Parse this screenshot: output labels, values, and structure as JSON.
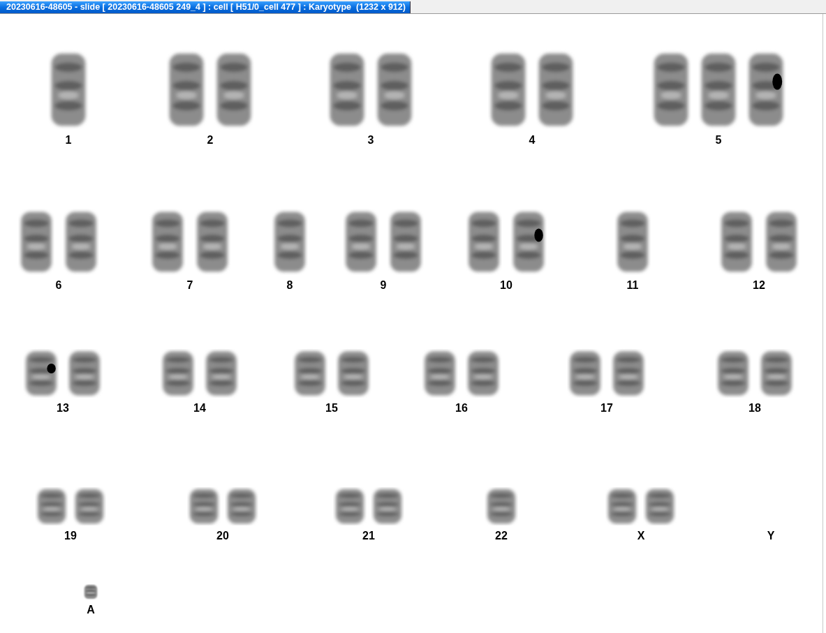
{
  "window": {
    "title": "20230616-48605 - slide [ 20230616-48605 249_4 ] : cell [ H51/0_cell 477 ] : Karyotype  (1232 x 912)"
  },
  "rows": [
    {
      "groups": [
        {
          "label": "1",
          "chromosomes": [
            {
              "kind": "normal"
            }
          ]
        },
        {
          "label": "2",
          "chromosomes": [
            {
              "kind": "normal"
            },
            {
              "kind": "normal"
            }
          ]
        },
        {
          "label": "3",
          "chromosomes": [
            {
              "kind": "normal"
            },
            {
              "kind": "normal"
            }
          ]
        },
        {
          "label": "4",
          "chromosomes": [
            {
              "kind": "normal"
            },
            {
              "kind": "normal"
            }
          ]
        },
        {
          "label": "5",
          "chromosomes": [
            {
              "kind": "normal"
            },
            {
              "kind": "normal"
            },
            {
              "kind": "marked"
            }
          ]
        }
      ]
    },
    {
      "groups": [
        {
          "label": "6",
          "chromosomes": [
            {
              "kind": "normal"
            },
            {
              "kind": "normal"
            }
          ]
        },
        {
          "label": "7",
          "chromosomes": [
            {
              "kind": "normal"
            },
            {
              "kind": "normal"
            }
          ]
        },
        {
          "label": "8",
          "chromosomes": [
            {
              "kind": "normal"
            }
          ]
        },
        {
          "label": "9",
          "chromosomes": [
            {
              "kind": "normal"
            },
            {
              "kind": "normal"
            }
          ]
        },
        {
          "label": "10",
          "chromosomes": [
            {
              "kind": "normal"
            },
            {
              "kind": "marked"
            }
          ]
        },
        {
          "label": "11",
          "chromosomes": [
            {
              "kind": "normal"
            }
          ]
        },
        {
          "label": "12",
          "chromosomes": [
            {
              "kind": "normal"
            },
            {
              "kind": "normal"
            }
          ]
        }
      ]
    },
    {
      "groups": [
        {
          "label": "13",
          "chromosomes": [
            {
              "kind": "marked"
            },
            {
              "kind": "normal"
            }
          ]
        },
        {
          "label": "14",
          "chromosomes": [
            {
              "kind": "normal"
            },
            {
              "kind": "normal"
            }
          ]
        },
        {
          "label": "15",
          "chromosomes": [
            {
              "kind": "normal"
            },
            {
              "kind": "normal"
            }
          ]
        },
        {
          "label": "16",
          "chromosomes": [
            {
              "kind": "normal"
            },
            {
              "kind": "normal"
            }
          ]
        },
        {
          "label": "17",
          "chromosomes": [
            {
              "kind": "normal"
            },
            {
              "kind": "normal"
            }
          ]
        },
        {
          "label": "18",
          "chromosomes": [
            {
              "kind": "normal"
            },
            {
              "kind": "normal"
            }
          ]
        }
      ]
    },
    {
      "groups": [
        {
          "label": "19",
          "chromosomes": [
            {
              "kind": "normal"
            },
            {
              "kind": "normal"
            }
          ]
        },
        {
          "label": "20",
          "chromosomes": [
            {
              "kind": "normal"
            },
            {
              "kind": "normal"
            }
          ]
        },
        {
          "label": "21",
          "chromosomes": [
            {
              "kind": "normal"
            },
            {
              "kind": "normal"
            }
          ]
        },
        {
          "label": "22",
          "chromosomes": [
            {
              "kind": "normal"
            }
          ]
        },
        {
          "label": "X",
          "chromosomes": [
            {
              "kind": "normal"
            },
            {
              "kind": "normal"
            }
          ]
        },
        {
          "label": "Y"
        }
      ]
    },
    {
      "groups": [
        {
          "label": "A",
          "chromosomes": [
            {
              "kind": "normal"
            }
          ]
        }
      ]
    }
  ]
}
